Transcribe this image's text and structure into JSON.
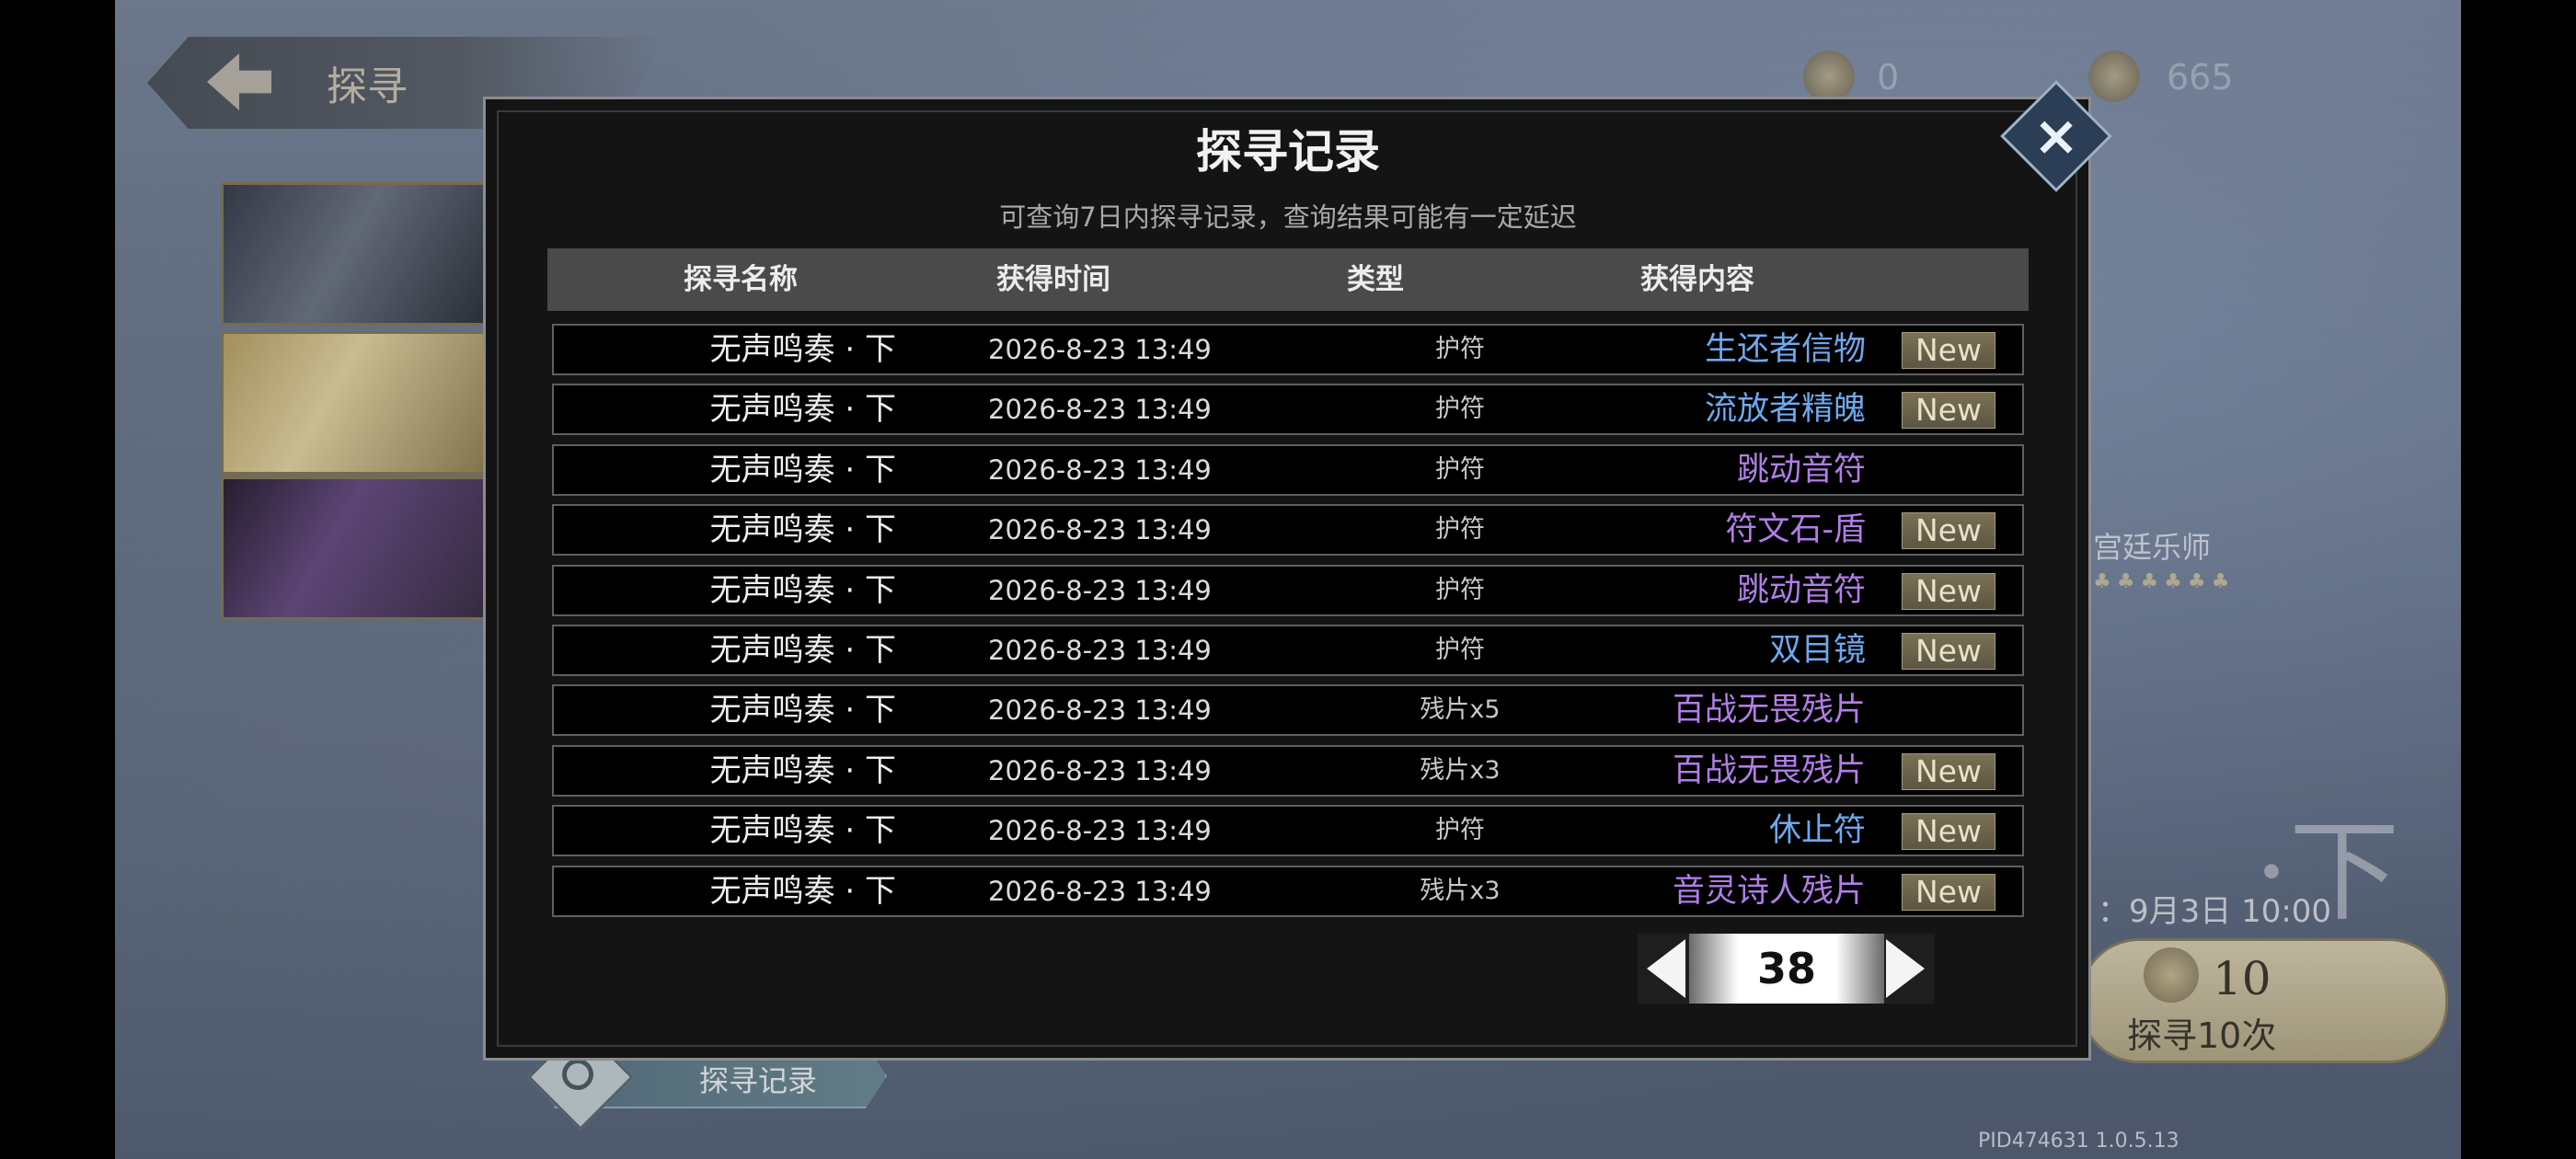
{
  "background": {
    "back_title": "探寻",
    "currency_left": "0",
    "currency_right": "665",
    "right_label": "宫廷乐师",
    "right_big_char": "·下",
    "date_text": "：9月3日 10:00",
    "pull10": {
      "count": "10",
      "label": "探寻10次"
    },
    "version": "PID474631  1.0.5.13",
    "record_button_label": "探寻记录"
  },
  "modal": {
    "title": "探寻记录",
    "subtitle": "可查询7日内探寻记录，查询结果可能有一定延迟",
    "headers": [
      "探寻名称",
      "获得时间",
      "类型",
      "获得内容"
    ],
    "new_label": "New",
    "rows": [
      {
        "name": "无声鸣奏 · 下",
        "time": "2026-8-23 13:49",
        "type": "护符",
        "content": "生还者信物",
        "color": "blue",
        "new": true
      },
      {
        "name": "无声鸣奏 · 下",
        "time": "2026-8-23 13:49",
        "type": "护符",
        "content": "流放者精魄",
        "color": "blue",
        "new": true
      },
      {
        "name": "无声鸣奏 · 下",
        "time": "2026-8-23 13:49",
        "type": "护符",
        "content": "跳动音符",
        "color": "purple",
        "new": false
      },
      {
        "name": "无声鸣奏 · 下",
        "time": "2026-8-23 13:49",
        "type": "护符",
        "content": "符文石-盾",
        "color": "purple",
        "new": true
      },
      {
        "name": "无声鸣奏 · 下",
        "time": "2026-8-23 13:49",
        "type": "护符",
        "content": "跳动音符",
        "color": "purple",
        "new": true
      },
      {
        "name": "无声鸣奏 · 下",
        "time": "2026-8-23 13:49",
        "type": "护符",
        "content": "双目镜",
        "color": "blue",
        "new": true
      },
      {
        "name": "无声鸣奏 · 下",
        "time": "2026-8-23 13:49",
        "type": "残片x5",
        "content": "百战无畏残片",
        "color": "purple",
        "new": false
      },
      {
        "name": "无声鸣奏 · 下",
        "time": "2026-8-23 13:49",
        "type": "残片x3",
        "content": "百战无畏残片",
        "color": "purple",
        "new": true
      },
      {
        "name": "无声鸣奏 · 下",
        "time": "2026-8-23 13:49",
        "type": "护符",
        "content": "休止符",
        "color": "blue",
        "new": true
      },
      {
        "name": "无声鸣奏 · 下",
        "time": "2026-8-23 13:49",
        "type": "残片x3",
        "content": "音灵诗人残片",
        "color": "purple",
        "new": true
      }
    ],
    "pager": {
      "page": "38"
    }
  }
}
